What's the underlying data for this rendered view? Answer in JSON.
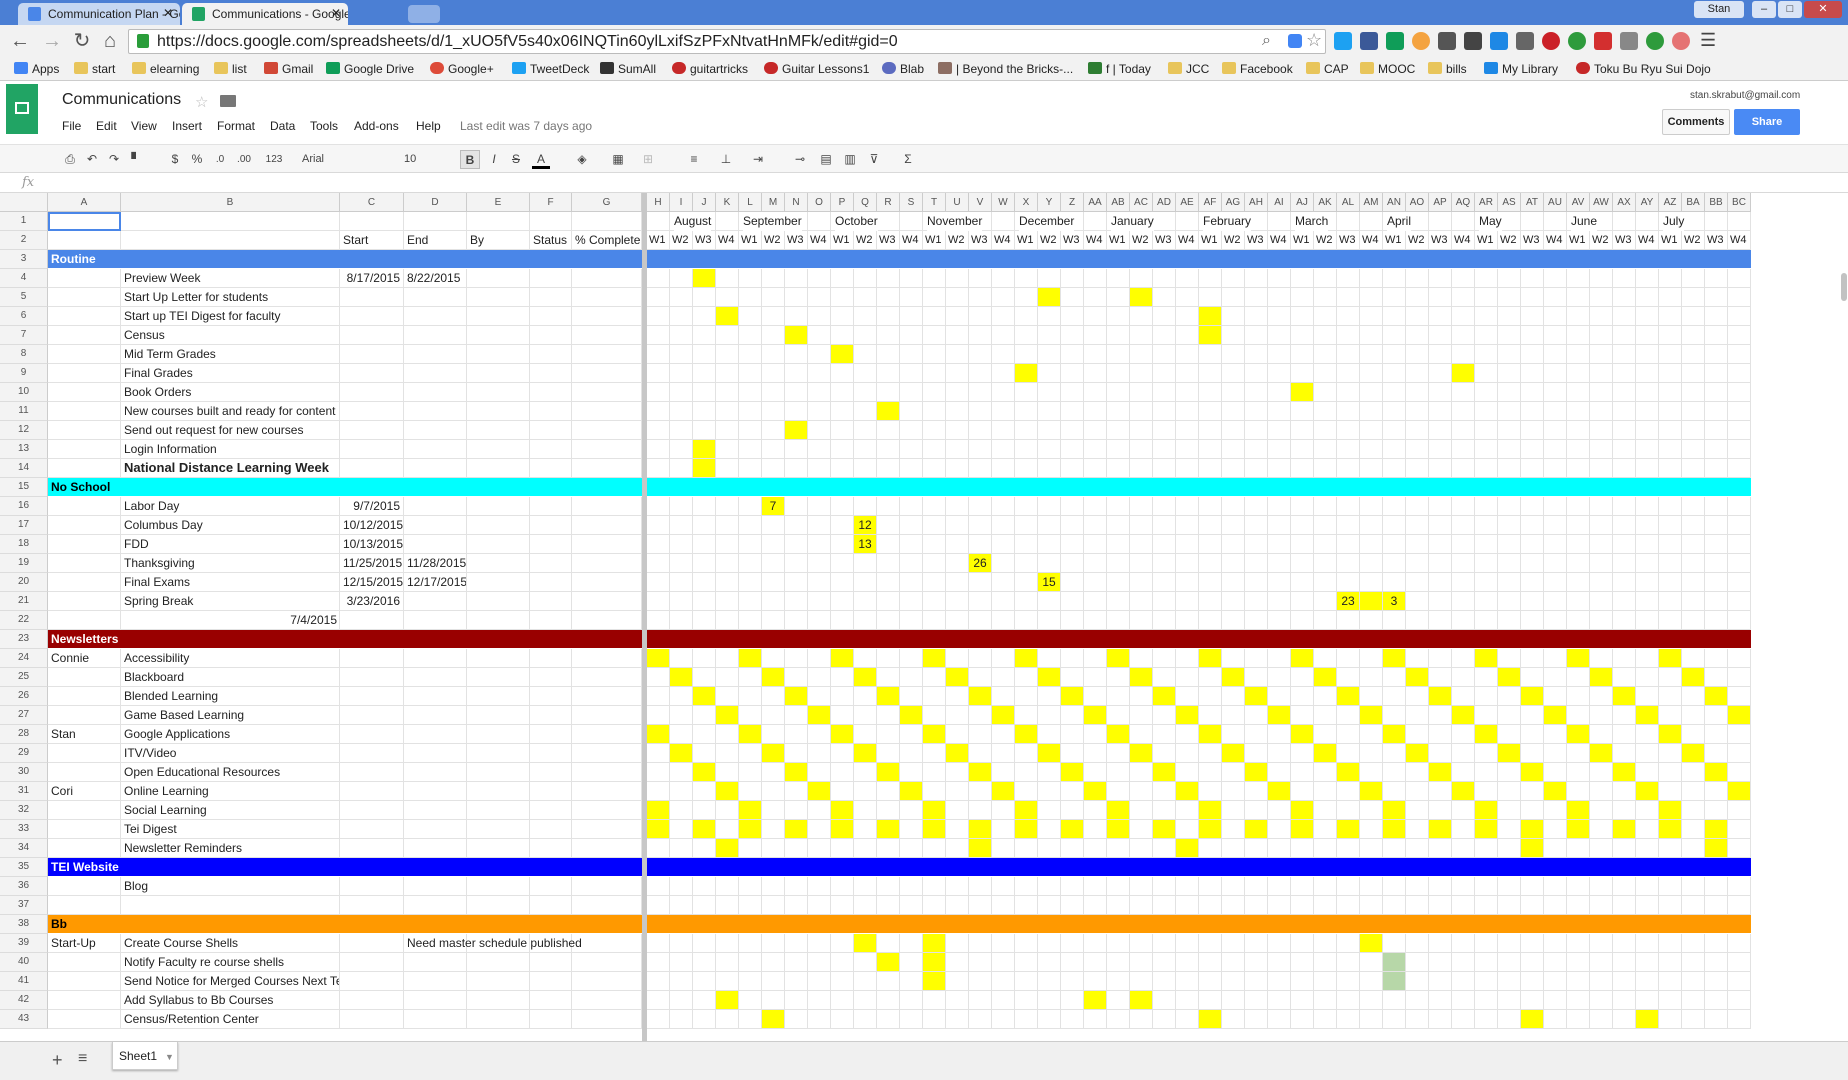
{
  "browser": {
    "tabs": [
      "Communication Plan - Goo",
      "Communications - Google"
    ],
    "url": "https://docs.google.com/spreadsheets/d/1_xUO5fV5s40x06INQTin60ylLxifSzPFxNtvatHnMFk/edit#gid=0",
    "user": "Stan",
    "bookmarks": [
      "Apps",
      "start",
      "elearning",
      "list",
      "Gmail",
      "Google Drive",
      "Google+",
      "TweetDeck",
      "SumAll",
      "guitartricks",
      "Guitar Lessons1",
      "Blab",
      "| Beyond the Bricks-...",
      "f | Today",
      "JCC",
      "Facebook",
      "CAP",
      "MOOC",
      "bills",
      "My Library",
      "Toku Bu Ryu Sui Dojo"
    ]
  },
  "app": {
    "title": "Communications",
    "menus": [
      "File",
      "Edit",
      "View",
      "Insert",
      "Format",
      "Data",
      "Tools",
      "Add-ons",
      "Help"
    ],
    "last_edit": "Last edit was 7 days ago",
    "account": "stan.skrabut@gmail.com",
    "comments": "Comments",
    "share": "Share"
  },
  "toolbar": {
    "font": "Arial",
    "size": "10",
    "currency": "$",
    "percent": "%",
    "dec_less": ".0",
    "dec_more": ".00",
    "more_formats": "123",
    "bold": "B",
    "italic": "I",
    "strike": "S",
    "textcolor": "A",
    "sum": "Σ"
  },
  "fx": "fx",
  "columns_left": [
    "A",
    "B",
    "C",
    "D",
    "E",
    "F",
    "G"
  ],
  "columns_right": [
    "H",
    "I",
    "J",
    "K",
    "L",
    "M",
    "N",
    "O",
    "P",
    "Q",
    "R",
    "S",
    "T",
    "U",
    "V",
    "W",
    "X",
    "Y",
    "Z",
    "AA",
    "AB",
    "AC",
    "AD",
    "AE",
    "AF",
    "AG",
    "AH",
    "AI",
    "AJ",
    "AK",
    "AL",
    "AM",
    "AN",
    "AO",
    "AP",
    "AQ",
    "AR",
    "AS",
    "AT",
    "AU",
    "AV",
    "AW",
    "AX",
    "AY",
    "AZ",
    "BA",
    "BB",
    "BC"
  ],
  "months": [
    [
      "August",
      1
    ],
    [
      "September",
      4
    ],
    [
      "October",
      8
    ],
    [
      "November",
      12
    ],
    [
      "December",
      16
    ],
    [
      "January",
      20
    ],
    [
      "February",
      24
    ],
    [
      "March",
      28
    ],
    [
      "April",
      32
    ],
    [
      "May",
      36
    ],
    [
      "June",
      40
    ],
    [
      "July",
      44
    ]
  ],
  "weeks": [
    "W1",
    "W2",
    "W3",
    "W4",
    "W1",
    "W2",
    "W3",
    "W4",
    "W1",
    "W2",
    "W3",
    "W4",
    "W1",
    "W2",
    "W3",
    "W4",
    "W1",
    "W2",
    "W3",
    "W4",
    "W1",
    "W2",
    "W3",
    "W4",
    "W1",
    "W2",
    "W3",
    "W4",
    "W1",
    "W2",
    "W3",
    "W4",
    "W1",
    "W2",
    "W3",
    "W4",
    "W1",
    "W2",
    "W3",
    "W4",
    "W1",
    "W2",
    "W3",
    "W4",
    "W1",
    "W2",
    "W3",
    "W4"
  ],
  "header_row2": [
    "",
    "",
    "Start",
    "End",
    "By",
    "Status",
    "% Complete"
  ],
  "rows": [
    {
      "n": "1",
      "a": "",
      "b": ""
    },
    {
      "n": "2",
      "a": "",
      "b": ""
    },
    {
      "n": "3",
      "section": "Routine",
      "color": "#4a86e8",
      "text": "#ffffff"
    },
    {
      "n": "4",
      "b": "Preview Week",
      "c": "8/17/2015",
      "d": "8/22/2015",
      "y": [
        [
          2,
          ""
        ]
      ]
    },
    {
      "n": "5",
      "b": "Start Up Letter for students",
      "y": [
        [
          17,
          ""
        ],
        [
          21,
          ""
        ]
      ]
    },
    {
      "n": "6",
      "b": "Start up TEI Digest for faculty",
      "y": [
        [
          3,
          ""
        ],
        [
          24,
          ""
        ]
      ]
    },
    {
      "n": "7",
      "b": "Census",
      "y": [
        [
          6,
          ""
        ],
        [
          24,
          ""
        ]
      ]
    },
    {
      "n": "8",
      "b": "Mid Term Grades",
      "y": [
        [
          8,
          ""
        ]
      ]
    },
    {
      "n": "9",
      "b": "Final Grades",
      "y": [
        [
          16,
          ""
        ],
        [
          35,
          ""
        ]
      ]
    },
    {
      "n": "10",
      "b": "Book Orders",
      "y": [
        [
          28,
          ""
        ]
      ]
    },
    {
      "n": "11",
      "b": "New courses built and ready for content",
      "y": [
        [
          10,
          ""
        ]
      ]
    },
    {
      "n": "12",
      "b": "Send out request for new courses",
      "y": [
        [
          6,
          ""
        ]
      ]
    },
    {
      "n": "13",
      "b": "Login Information",
      "y": [
        [
          2,
          ""
        ]
      ]
    },
    {
      "n": "14",
      "b": "National Distance Learning Week",
      "bold": true,
      "y": [
        [
          2,
          ""
        ]
      ]
    },
    {
      "n": "15",
      "section": "No School",
      "color": "#00ffff",
      "text": "#000000"
    },
    {
      "n": "16",
      "b": "Labor Day",
      "c": "9/7/2015",
      "y": [
        [
          5,
          "7"
        ]
      ]
    },
    {
      "n": "17",
      "b": "Columbus Day",
      "c": "10/12/2015",
      "y": [
        [
          9,
          "12"
        ]
      ]
    },
    {
      "n": "18",
      "b": "FDD",
      "c": "10/13/2015",
      "y": [
        [
          9,
          "13"
        ]
      ]
    },
    {
      "n": "19",
      "b": "Thanksgiving",
      "c": "11/25/2015",
      "d": "11/28/2015",
      "y": [
        [
          14,
          "26"
        ]
      ]
    },
    {
      "n": "20",
      "b": "Final Exams",
      "c": "12/15/2015",
      "d": "12/17/2015",
      "y": [
        [
          17,
          "15"
        ]
      ]
    },
    {
      "n": "21",
      "b": "Spring Break",
      "c": "3/23/2016",
      "y": [
        [
          30,
          "23"
        ],
        [
          31,
          ""
        ],
        [
          32,
          "3"
        ]
      ]
    },
    {
      "n": "22",
      "b": "",
      "b_right": "7/4/2015"
    },
    {
      "n": "23",
      "section": "Newsletters",
      "color": "#990000",
      "text": "#ffffff"
    },
    {
      "n": "24",
      "a": "Connie",
      "b": "Accessibility",
      "y": [
        [
          0,
          ""
        ],
        [
          4,
          ""
        ],
        [
          8,
          ""
        ],
        [
          12,
          ""
        ],
        [
          16,
          ""
        ],
        [
          20,
          ""
        ],
        [
          24,
          ""
        ],
        [
          28,
          ""
        ],
        [
          32,
          ""
        ],
        [
          36,
          ""
        ],
        [
          40,
          ""
        ],
        [
          44,
          ""
        ]
      ]
    },
    {
      "n": "25",
      "b": "Blackboard",
      "y": [
        [
          1,
          ""
        ],
        [
          5,
          ""
        ],
        [
          9,
          ""
        ],
        [
          13,
          ""
        ],
        [
          17,
          ""
        ],
        [
          21,
          ""
        ],
        [
          25,
          ""
        ],
        [
          29,
          ""
        ],
        [
          33,
          ""
        ],
        [
          37,
          ""
        ],
        [
          41,
          ""
        ],
        [
          45,
          ""
        ]
      ]
    },
    {
      "n": "26",
      "b": "Blended Learning",
      "y": [
        [
          2,
          ""
        ],
        [
          6,
          ""
        ],
        [
          10,
          ""
        ],
        [
          14,
          ""
        ],
        [
          18,
          ""
        ],
        [
          22,
          ""
        ],
        [
          26,
          ""
        ],
        [
          30,
          ""
        ],
        [
          34,
          ""
        ],
        [
          38,
          ""
        ],
        [
          42,
          ""
        ],
        [
          46,
          ""
        ]
      ]
    },
    {
      "n": "27",
      "b": "Game Based Learning",
      "y": [
        [
          3,
          ""
        ],
        [
          7,
          ""
        ],
        [
          11,
          ""
        ],
        [
          15,
          ""
        ],
        [
          19,
          ""
        ],
        [
          23,
          ""
        ],
        [
          27,
          ""
        ],
        [
          31,
          ""
        ],
        [
          35,
          ""
        ],
        [
          39,
          ""
        ],
        [
          43,
          ""
        ],
        [
          47,
          ""
        ]
      ]
    },
    {
      "n": "28",
      "a": "Stan",
      "b": "Google Applications",
      "y": [
        [
          0,
          ""
        ],
        [
          4,
          ""
        ],
        [
          8,
          ""
        ],
        [
          12,
          ""
        ],
        [
          16,
          ""
        ],
        [
          20,
          ""
        ],
        [
          24,
          ""
        ],
        [
          28,
          ""
        ],
        [
          32,
          ""
        ],
        [
          36,
          ""
        ],
        [
          40,
          ""
        ],
        [
          44,
          ""
        ]
      ]
    },
    {
      "n": "29",
      "b": "ITV/Video",
      "y": [
        [
          1,
          ""
        ],
        [
          5,
          ""
        ],
        [
          9,
          ""
        ],
        [
          13,
          ""
        ],
        [
          17,
          ""
        ],
        [
          21,
          ""
        ],
        [
          25,
          ""
        ],
        [
          29,
          ""
        ],
        [
          33,
          ""
        ],
        [
          37,
          ""
        ],
        [
          41,
          ""
        ],
        [
          45,
          ""
        ]
      ]
    },
    {
      "n": "30",
      "b": "Open Educational Resources",
      "y": [
        [
          2,
          ""
        ],
        [
          6,
          ""
        ],
        [
          10,
          ""
        ],
        [
          14,
          ""
        ],
        [
          18,
          ""
        ],
        [
          22,
          ""
        ],
        [
          26,
          ""
        ],
        [
          30,
          ""
        ],
        [
          34,
          ""
        ],
        [
          38,
          ""
        ],
        [
          42,
          ""
        ],
        [
          46,
          ""
        ]
      ]
    },
    {
      "n": "31",
      "a": "Cori",
      "b": "Online Learning",
      "y": [
        [
          3,
          ""
        ],
        [
          7,
          ""
        ],
        [
          11,
          ""
        ],
        [
          15,
          ""
        ],
        [
          19,
          ""
        ],
        [
          23,
          ""
        ],
        [
          27,
          ""
        ],
        [
          31,
          ""
        ],
        [
          35,
          ""
        ],
        [
          39,
          ""
        ],
        [
          43,
          ""
        ],
        [
          47,
          ""
        ]
      ]
    },
    {
      "n": "32",
      "b": "Social Learning",
      "y": [
        [
          0,
          ""
        ],
        [
          4,
          ""
        ],
        [
          8,
          ""
        ],
        [
          12,
          ""
        ],
        [
          16,
          ""
        ],
        [
          20,
          ""
        ],
        [
          24,
          ""
        ],
        [
          28,
          ""
        ],
        [
          32,
          ""
        ],
        [
          36,
          ""
        ],
        [
          40,
          ""
        ],
        [
          44,
          ""
        ]
      ]
    },
    {
      "n": "33",
      "b": "Tei Digest",
      "y": [
        [
          0,
          ""
        ],
        [
          2,
          ""
        ],
        [
          4,
          ""
        ],
        [
          6,
          ""
        ],
        [
          8,
          ""
        ],
        [
          10,
          ""
        ],
        [
          12,
          ""
        ],
        [
          14,
          ""
        ],
        [
          16,
          ""
        ],
        [
          18,
          ""
        ],
        [
          20,
          ""
        ],
        [
          22,
          ""
        ],
        [
          24,
          ""
        ],
        [
          26,
          ""
        ],
        [
          28,
          ""
        ],
        [
          30,
          ""
        ],
        [
          32,
          ""
        ],
        [
          34,
          ""
        ],
        [
          36,
          ""
        ],
        [
          38,
          ""
        ],
        [
          40,
          ""
        ],
        [
          42,
          ""
        ],
        [
          44,
          ""
        ],
        [
          46,
          ""
        ]
      ]
    },
    {
      "n": "34",
      "b": "Newsletter Reminders",
      "y": [
        [
          3,
          ""
        ],
        [
          14,
          ""
        ],
        [
          23,
          ""
        ],
        [
          38,
          ""
        ],
        [
          46,
          ""
        ]
      ]
    },
    {
      "n": "35",
      "section": "TEI Website",
      "color": "#0000ff",
      "text": "#ffffff"
    },
    {
      "n": "36",
      "b": "Blog"
    },
    {
      "n": "37",
      "b": ""
    },
    {
      "n": "38",
      "section": "Bb",
      "color": "#ff9900",
      "text": "#000000"
    },
    {
      "n": "39",
      "a": "Start-Up",
      "b": "Create Course Shells",
      "d": "Need master schedule published",
      "y": [
        [
          9,
          ""
        ],
        [
          12,
          ""
        ],
        [
          31,
          ""
        ]
      ]
    },
    {
      "n": "40",
      "b": "Notify Faculty re course shells",
      "y": [
        [
          10,
          ""
        ],
        [
          12,
          ""
        ]
      ],
      "g": [
        [
          32
        ]
      ]
    },
    {
      "n": "41",
      "b": "Send Notice for Merged Courses Next Term",
      "y": [
        [
          12,
          ""
        ]
      ],
      "g": [
        [
          32
        ]
      ]
    },
    {
      "n": "42",
      "b": "Add Syllabus to Bb Courses",
      "y": [
        [
          3,
          ""
        ],
        [
          19,
          ""
        ],
        [
          21,
          ""
        ]
      ]
    },
    {
      "n": "43",
      "b": "Census/Retention Center",
      "y": [
        [
          5,
          ""
        ],
        [
          24,
          ""
        ],
        [
          38,
          ""
        ],
        [
          43,
          ""
        ]
      ]
    }
  ],
  "sheet_tab": "Sheet1",
  "colors": {
    "accent": "#4a8af4",
    "yellow": "#ffff00",
    "green": "#b7d7a8"
  }
}
